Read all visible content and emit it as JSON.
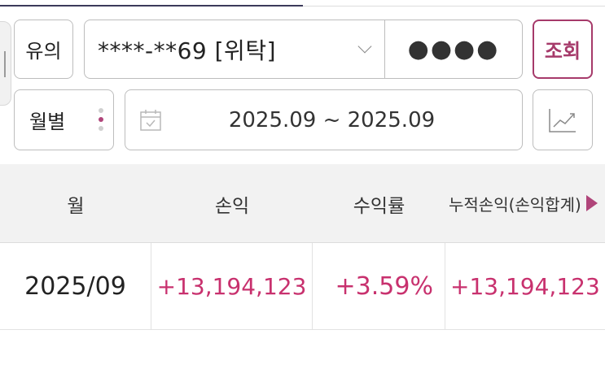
{
  "colors": {
    "accent": "#a63a6a",
    "profit": "#c8316e",
    "header_bg": "#f2f2f2",
    "border": "#bdbdbd"
  },
  "controls": {
    "notice_label": "유의",
    "account_value": "****-**69 [위탁]",
    "password_mask": "●●●●",
    "query_label": "조회",
    "period_label": "월별",
    "date_range": "2025.09 ~ 2025.09",
    "icons": [
      "calendar-icon",
      "chart-line-icon",
      "chevron-down-icon",
      "kebab-menu-icon"
    ]
  },
  "table": {
    "headers": [
      "월",
      "손익",
      "수익률",
      "누적손익(손익합계)"
    ],
    "rows": [
      {
        "month": "2025/09",
        "pnl": "+13,194,123",
        "return_rate": "+3.59%",
        "cum_pnl": "+13,194,123"
      }
    ]
  }
}
